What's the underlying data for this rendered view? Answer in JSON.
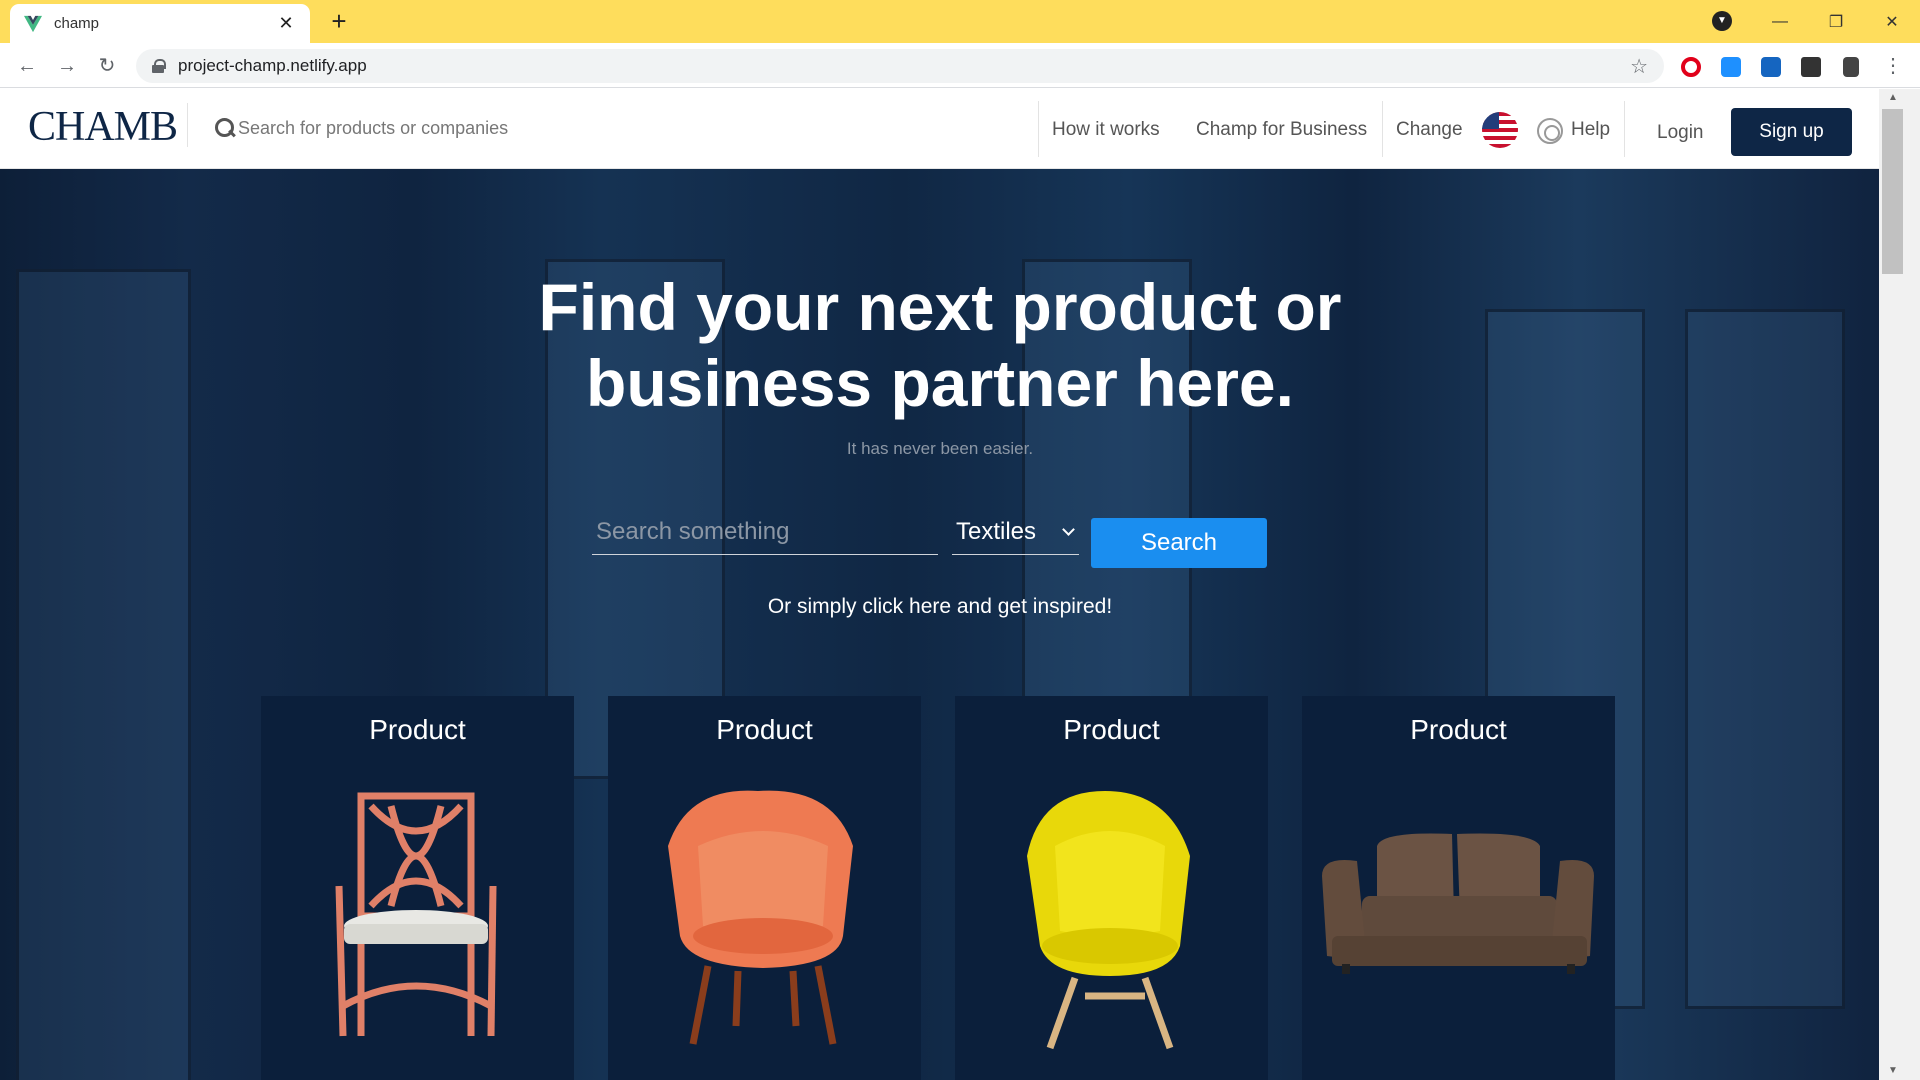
{
  "browser": {
    "tab_title": "champ",
    "tab_close": "✕",
    "new_tab": "+",
    "url": "project-champ.netlify.app",
    "window_controls": [
      "—",
      "❐",
      "✕"
    ]
  },
  "header": {
    "logo": "CHAMB",
    "search_placeholder": "Search for products or companies",
    "nav": {
      "how_it_works": "How it works",
      "champ_for_business": "Champ for Business",
      "change": "Change",
      "help": "Help",
      "login": "Login",
      "signup": "Sign up"
    }
  },
  "hero": {
    "title_line1": "Find your next product or",
    "title_line2": "business partner here.",
    "subtitle": "It has never been easier.",
    "search_placeholder": "Search something",
    "category": "Textiles",
    "search_button": "Search",
    "inspire_link": "Or simply click here and get inspired!"
  },
  "cards": [
    {
      "title": "Product",
      "image": "salmon wooden armchair"
    },
    {
      "title": "Product",
      "image": "orange upholstered chair"
    },
    {
      "title": "Product",
      "image": "yellow upholstered chair"
    },
    {
      "title": "Product",
      "image": "brown two-seater sofa"
    }
  ],
  "colors": {
    "brand_navy": "#0e2646",
    "accent_blue": "#1a8ef0",
    "chrome_yellow": "#fedd5c"
  }
}
